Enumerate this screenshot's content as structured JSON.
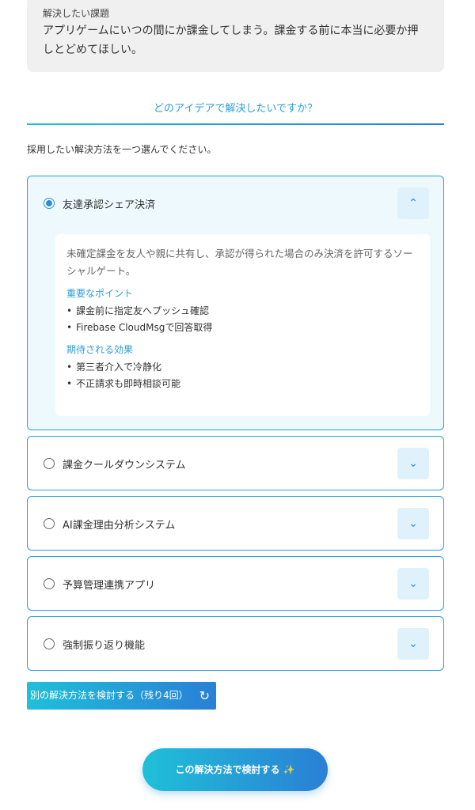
{
  "problem": {
    "label": "解決したい課題",
    "text": "アプリゲームにいつの間にか課金してしまう。課金する前に本当に必要か押しとどめてほしい。"
  },
  "question": "どのアイデアで解決したいですか？",
  "instruction": "採用したい解決方法を一つ選んでください。",
  "options": [
    {
      "title": "友達承認シェア決済",
      "selected": true,
      "expanded": true,
      "description": "未確定課金を友人や親に共有し、承認が得られた場合のみ決済を許可するソーシャルゲート。",
      "points_label": "重要なポイント",
      "points": [
        "課金前に指定友へプッシュ確認",
        "Firebase CloudMsgで回答取得"
      ],
      "effects_label": "期待される効果",
      "effects": [
        "第三者介入で冷静化",
        "不正請求も即時相談可能"
      ]
    },
    {
      "title": "課金クールダウンシステム",
      "selected": false,
      "expanded": false
    },
    {
      "title": "AI課金理由分析システム",
      "selected": false,
      "expanded": false
    },
    {
      "title": "予算管理連携アプリ",
      "selected": false,
      "expanded": false
    },
    {
      "title": "強制振り返り機能",
      "selected": false,
      "expanded": false
    }
  ],
  "retry_button": {
    "label": "別の解決方法を検討する（残り4回）",
    "icon": "refresh-icon"
  },
  "submit_button": {
    "label": "この解決方法で検討する",
    "icon": "magic-wand-icon"
  },
  "colors": {
    "accent": "#2a9fd6",
    "gradient_start": "#1fc0d8",
    "gradient_end": "#2a7fd6"
  }
}
